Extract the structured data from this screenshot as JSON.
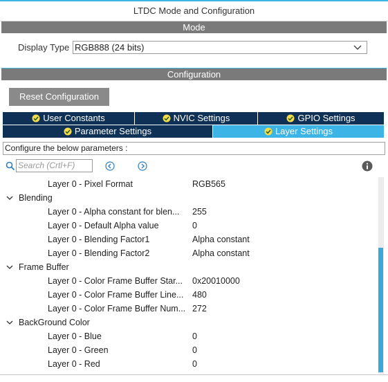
{
  "window": {
    "title": "LTDC Mode and Configuration"
  },
  "mode_section": {
    "title": "Mode"
  },
  "display_type": {
    "label": "Display Type",
    "value": "RGB888 (24 bits)"
  },
  "config_section": {
    "title": "Configuration"
  },
  "reset_button": "Reset Configuration",
  "tabs": {
    "row1": [
      "User Constants",
      "NVIC Settings",
      "GPIO Settings"
    ],
    "row2": [
      "Parameter Settings",
      "Layer Settings"
    ],
    "active": "Layer Settings"
  },
  "hint": "Configure the below parameters :",
  "search": {
    "placeholder": "Search (Crtl+F)"
  },
  "tree": {
    "top_row": {
      "name": "Layer 0 - Pixel Format",
      "value": "RGB565"
    },
    "groups": [
      {
        "name": "Blending",
        "items": [
          {
            "name": "Layer 0 - Alpha constant for blen...",
            "value": "255"
          },
          {
            "name": "Layer 0 - Default Alpha value",
            "value": "0"
          },
          {
            "name": "Layer 0 - Blending Factor1",
            "value": "Alpha constant"
          },
          {
            "name": "Layer 0 - Blending Factor2",
            "value": "Alpha constant"
          }
        ]
      },
      {
        "name": "Frame Buffer",
        "items": [
          {
            "name": "Layer 0 - Color Frame Buffer Star...",
            "value": "0x20010000"
          },
          {
            "name": "Layer 0 - Color Frame Buffer Line...",
            "value": "480"
          },
          {
            "name": "Layer 0 - Color Frame Buffer Num...",
            "value": "272"
          }
        ]
      },
      {
        "name": "BackGround Color",
        "items": [
          {
            "name": "Layer 0 - Blue",
            "value": "0"
          },
          {
            "name": "Layer 0 - Green",
            "value": "0"
          },
          {
            "name": "Layer 0 - Red",
            "value": "0"
          }
        ]
      }
    ]
  },
  "colors": {
    "accent": "#3cb4e5",
    "tab_dark": "#0f3155",
    "section_gray": "#7a7a7a",
    "check_yellow": "#f2dc4a"
  }
}
